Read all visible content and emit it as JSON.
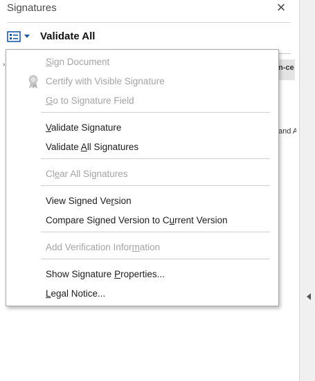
{
  "panel": {
    "title": "Signatures",
    "close_glyph": "×",
    "close_icon": "close-icon",
    "options_icon": "list-options-icon",
    "validate_all": "Validate All"
  },
  "background": {
    "field_fragment": "n-ce",
    "text_fragment": "and A"
  },
  "menu": {
    "items": [
      {
        "pre": "",
        "u": "S",
        "post": "ign Document",
        "enabled": false
      },
      {
        "pre": "Certify with Visible Signature",
        "u": "",
        "post": "",
        "enabled": false,
        "icon": "certify-ribbon-icon"
      },
      {
        "pre": "",
        "u": "G",
        "post": "o to Signature Field",
        "enabled": false
      },
      {
        "pre": "",
        "u": "V",
        "post": "alidate Signature",
        "enabled": true
      },
      {
        "pre": "Validate ",
        "u": "A",
        "post": "ll Signatures",
        "enabled": true
      },
      {
        "pre": "Cl",
        "u": "e",
        "post": "ar All Signatures",
        "enabled": false
      },
      {
        "pre": "View Signed Ve",
        "u": "r",
        "post": "sion",
        "enabled": true
      },
      {
        "pre": "Compare Signed Version to C",
        "u": "u",
        "post": "rrent Version",
        "enabled": true
      },
      {
        "pre": "Add Verification Infor",
        "u": "m",
        "post": "ation",
        "enabled": false
      },
      {
        "pre": "Show Signature ",
        "u": "P",
        "post": "roperties...",
        "enabled": true
      },
      {
        "pre": "",
        "u": "L",
        "post": "egal Notice...",
        "enabled": true
      }
    ]
  },
  "colors": {
    "accent": "#1a5aa8",
    "disabled_text": "#a3a3a3",
    "separator": "#cfcfcf"
  }
}
